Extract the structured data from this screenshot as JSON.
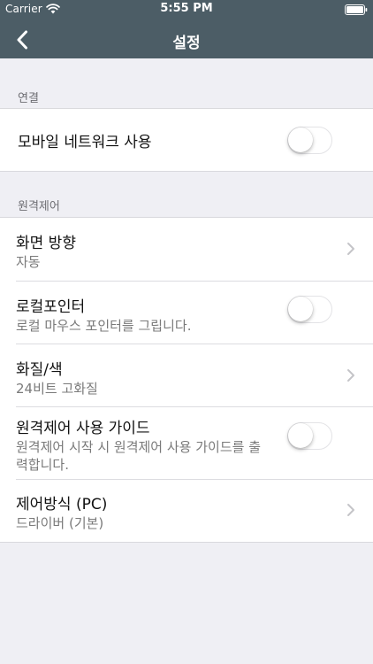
{
  "status_bar": {
    "carrier": "Carrier",
    "time": "5:55 PM"
  },
  "nav": {
    "title": "설정"
  },
  "sections": [
    {
      "header": "연결",
      "rows": [
        {
          "title": "모바일 네트워크 사용",
          "control": "toggle",
          "on": false
        }
      ]
    },
    {
      "header": "원격제어",
      "rows": [
        {
          "title": "화면 방향",
          "subtitle": "자동",
          "control": "chevron"
        },
        {
          "title": "로컬포인터",
          "subtitle": "로컬 마우스 포인터를 그립니다.",
          "control": "toggle",
          "on": false
        },
        {
          "title": "화질/색",
          "subtitle": "24비트 고화질",
          "control": "chevron"
        },
        {
          "title": "원격제어 사용 가이드",
          "subtitle": "원격제어 시작 시 원격제어 사용 가이드를 출력합니다.",
          "control": "toggle",
          "on": false
        },
        {
          "title": "제어방식 (PC)",
          "subtitle": "드라이버 (기본)",
          "control": "chevron"
        }
      ]
    }
  ],
  "colors": {
    "nav_background": "#4c5d66",
    "page_background": "#efeff4",
    "section_header_text": "#6d6d72",
    "subtitle_text": "#7a7a7a"
  },
  "icons": {
    "back": "chevron-left-icon",
    "wifi": "wifi-icon",
    "battery": "battery-icon",
    "disclosure": "chevron-right-icon"
  }
}
